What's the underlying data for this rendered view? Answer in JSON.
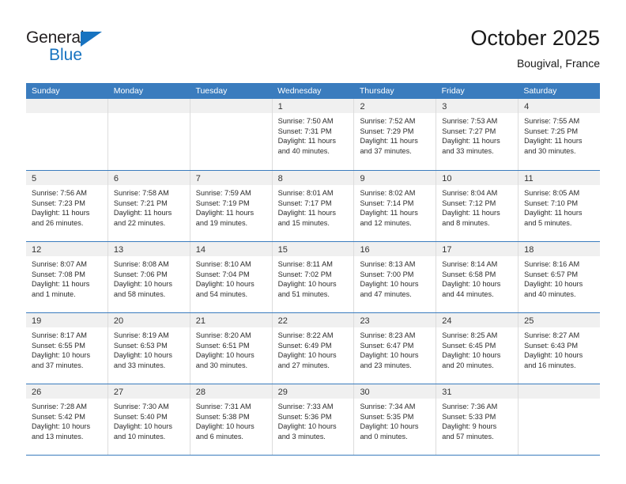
{
  "logo": {
    "text_primary": "General",
    "text_secondary": "Blue",
    "triangle_icon": "blue-triangle-icon",
    "primary_color": "#231f20",
    "secondary_color": "#1773c0"
  },
  "header": {
    "title": "October 2025",
    "subtitle": "Bougival, France"
  },
  "colors": {
    "header_row_bg": "#3a7cbe",
    "daynum_band_bg": "#f0f0f0",
    "cell_bg": "#ffffff",
    "grid_line": "#dcdcdc",
    "text": "#2b2b2b"
  },
  "weekday_headers": [
    "Sunday",
    "Monday",
    "Tuesday",
    "Wednesday",
    "Thursday",
    "Friday",
    "Saturday"
  ],
  "weeks": [
    [
      {
        "day": "",
        "lines": []
      },
      {
        "day": "",
        "lines": []
      },
      {
        "day": "",
        "lines": []
      },
      {
        "day": "1",
        "lines": [
          "Sunrise: 7:50 AM",
          "Sunset: 7:31 PM",
          "Daylight: 11 hours",
          "and 40 minutes."
        ]
      },
      {
        "day": "2",
        "lines": [
          "Sunrise: 7:52 AM",
          "Sunset: 7:29 PM",
          "Daylight: 11 hours",
          "and 37 minutes."
        ]
      },
      {
        "day": "3",
        "lines": [
          "Sunrise: 7:53 AM",
          "Sunset: 7:27 PM",
          "Daylight: 11 hours",
          "and 33 minutes."
        ]
      },
      {
        "day": "4",
        "lines": [
          "Sunrise: 7:55 AM",
          "Sunset: 7:25 PM",
          "Daylight: 11 hours",
          "and 30 minutes."
        ]
      }
    ],
    [
      {
        "day": "5",
        "lines": [
          "Sunrise: 7:56 AM",
          "Sunset: 7:23 PM",
          "Daylight: 11 hours",
          "and 26 minutes."
        ]
      },
      {
        "day": "6",
        "lines": [
          "Sunrise: 7:58 AM",
          "Sunset: 7:21 PM",
          "Daylight: 11 hours",
          "and 22 minutes."
        ]
      },
      {
        "day": "7",
        "lines": [
          "Sunrise: 7:59 AM",
          "Sunset: 7:19 PM",
          "Daylight: 11 hours",
          "and 19 minutes."
        ]
      },
      {
        "day": "8",
        "lines": [
          "Sunrise: 8:01 AM",
          "Sunset: 7:17 PM",
          "Daylight: 11 hours",
          "and 15 minutes."
        ]
      },
      {
        "day": "9",
        "lines": [
          "Sunrise: 8:02 AM",
          "Sunset: 7:14 PM",
          "Daylight: 11 hours",
          "and 12 minutes."
        ]
      },
      {
        "day": "10",
        "lines": [
          "Sunrise: 8:04 AM",
          "Sunset: 7:12 PM",
          "Daylight: 11 hours",
          "and 8 minutes."
        ]
      },
      {
        "day": "11",
        "lines": [
          "Sunrise: 8:05 AM",
          "Sunset: 7:10 PM",
          "Daylight: 11 hours",
          "and 5 minutes."
        ]
      }
    ],
    [
      {
        "day": "12",
        "lines": [
          "Sunrise: 8:07 AM",
          "Sunset: 7:08 PM",
          "Daylight: 11 hours",
          "and 1 minute."
        ]
      },
      {
        "day": "13",
        "lines": [
          "Sunrise: 8:08 AM",
          "Sunset: 7:06 PM",
          "Daylight: 10 hours",
          "and 58 minutes."
        ]
      },
      {
        "day": "14",
        "lines": [
          "Sunrise: 8:10 AM",
          "Sunset: 7:04 PM",
          "Daylight: 10 hours",
          "and 54 minutes."
        ]
      },
      {
        "day": "15",
        "lines": [
          "Sunrise: 8:11 AM",
          "Sunset: 7:02 PM",
          "Daylight: 10 hours",
          "and 51 minutes."
        ]
      },
      {
        "day": "16",
        "lines": [
          "Sunrise: 8:13 AM",
          "Sunset: 7:00 PM",
          "Daylight: 10 hours",
          "and 47 minutes."
        ]
      },
      {
        "day": "17",
        "lines": [
          "Sunrise: 8:14 AM",
          "Sunset: 6:58 PM",
          "Daylight: 10 hours",
          "and 44 minutes."
        ]
      },
      {
        "day": "18",
        "lines": [
          "Sunrise: 8:16 AM",
          "Sunset: 6:57 PM",
          "Daylight: 10 hours",
          "and 40 minutes."
        ]
      }
    ],
    [
      {
        "day": "19",
        "lines": [
          "Sunrise: 8:17 AM",
          "Sunset: 6:55 PM",
          "Daylight: 10 hours",
          "and 37 minutes."
        ]
      },
      {
        "day": "20",
        "lines": [
          "Sunrise: 8:19 AM",
          "Sunset: 6:53 PM",
          "Daylight: 10 hours",
          "and 33 minutes."
        ]
      },
      {
        "day": "21",
        "lines": [
          "Sunrise: 8:20 AM",
          "Sunset: 6:51 PM",
          "Daylight: 10 hours",
          "and 30 minutes."
        ]
      },
      {
        "day": "22",
        "lines": [
          "Sunrise: 8:22 AM",
          "Sunset: 6:49 PM",
          "Daylight: 10 hours",
          "and 27 minutes."
        ]
      },
      {
        "day": "23",
        "lines": [
          "Sunrise: 8:23 AM",
          "Sunset: 6:47 PM",
          "Daylight: 10 hours",
          "and 23 minutes."
        ]
      },
      {
        "day": "24",
        "lines": [
          "Sunrise: 8:25 AM",
          "Sunset: 6:45 PM",
          "Daylight: 10 hours",
          "and 20 minutes."
        ]
      },
      {
        "day": "25",
        "lines": [
          "Sunrise: 8:27 AM",
          "Sunset: 6:43 PM",
          "Daylight: 10 hours",
          "and 16 minutes."
        ]
      }
    ],
    [
      {
        "day": "26",
        "lines": [
          "Sunrise: 7:28 AM",
          "Sunset: 5:42 PM",
          "Daylight: 10 hours",
          "and 13 minutes."
        ]
      },
      {
        "day": "27",
        "lines": [
          "Sunrise: 7:30 AM",
          "Sunset: 5:40 PM",
          "Daylight: 10 hours",
          "and 10 minutes."
        ]
      },
      {
        "day": "28",
        "lines": [
          "Sunrise: 7:31 AM",
          "Sunset: 5:38 PM",
          "Daylight: 10 hours",
          "and 6 minutes."
        ]
      },
      {
        "day": "29",
        "lines": [
          "Sunrise: 7:33 AM",
          "Sunset: 5:36 PM",
          "Daylight: 10 hours",
          "and 3 minutes."
        ]
      },
      {
        "day": "30",
        "lines": [
          "Sunrise: 7:34 AM",
          "Sunset: 5:35 PM",
          "Daylight: 10 hours",
          "and 0 minutes."
        ]
      },
      {
        "day": "31",
        "lines": [
          "Sunrise: 7:36 AM",
          "Sunset: 5:33 PM",
          "Daylight: 9 hours",
          "and 57 minutes."
        ]
      },
      {
        "day": "",
        "lines": []
      }
    ]
  ]
}
